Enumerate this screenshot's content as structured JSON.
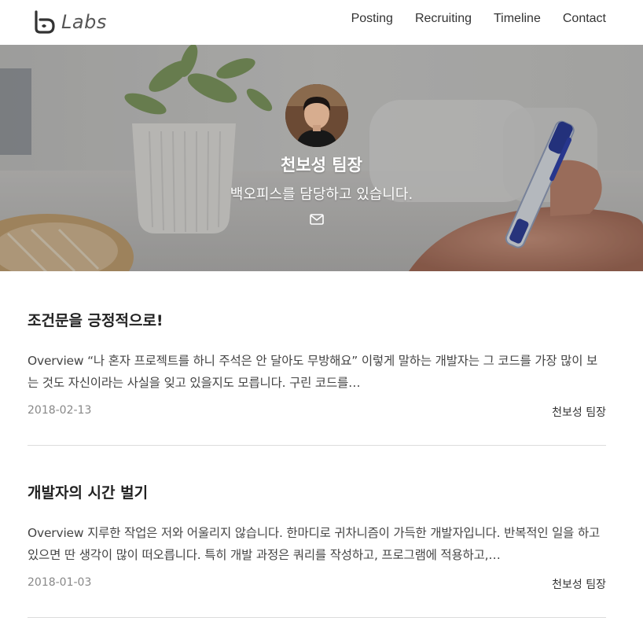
{
  "brand": {
    "name": "Labs"
  },
  "nav": [
    {
      "label": "Posting"
    },
    {
      "label": "Recruiting"
    },
    {
      "label": "Timeline"
    },
    {
      "label": "Contact"
    }
  ],
  "hero": {
    "name": "천보성 팀장",
    "description": "백오피스를 담당하고 있습니다."
  },
  "posts": [
    {
      "title": "조건문을 긍정적으로!",
      "summary": "Overview “나 혼자 프로젝트를 하니 주석은 안 달아도 무방해요” 이렇게 말하는 개발자는 그 코드를 가장 많이 보는 것도 자신이라는 사실을 잊고 있을지도 모릅니다. 구린 코드를…",
      "date": "2018-02-13",
      "author": "천보성 팀장"
    },
    {
      "title": "개발자의 시간 벌기",
      "summary": "Overview 지루한 작업은 저와 어울리지 않습니다. 한마디로 귀차니즘이 가득한 개발자입니다. 반복적인 일을 하고 있으면 딴 생각이 많이 떠오릅니다. 특히 개발 과정은 쿼리를 작성하고, 프로그램에 적용하고,…",
      "date": "2018-01-03",
      "author": "천보성 팀장"
    }
  ]
}
